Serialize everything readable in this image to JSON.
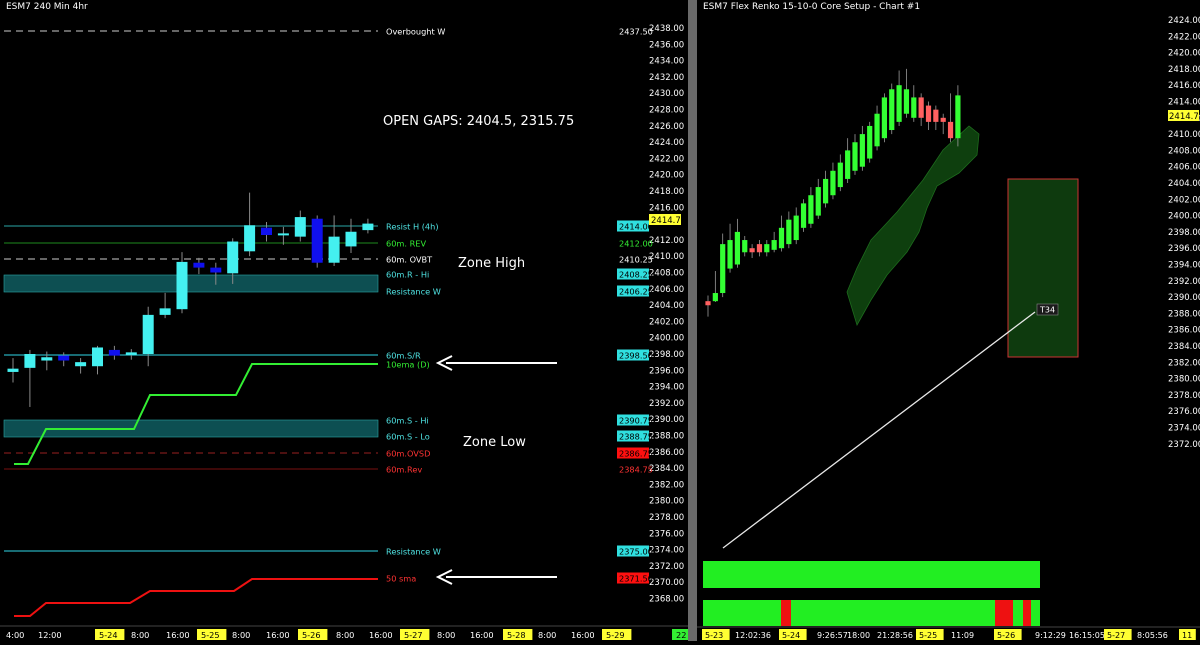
{
  "left_chart": {
    "title": "ESM7 240 Min  4hr",
    "open_gaps_text": "OPEN GAPS: 2404.5, 2315.75",
    "zone_high_label": "Zone High",
    "zone_low_label": "Zone Low",
    "y_ticks": [
      "2438.00",
      "2436.00",
      "2434.00",
      "2432.00",
      "2430.00",
      "2428.00",
      "2426.00",
      "2424.00",
      "2422.00",
      "2420.00",
      "2418.00",
      "2416.00",
      "2412.00",
      "2410.00",
      "2408.00",
      "2406.00",
      "2404.00",
      "2402.00",
      "2400.00",
      "2398.00",
      "2396.00",
      "2394.00",
      "2392.00",
      "2390.00",
      "2388.00",
      "2386.00",
      "2384.00",
      "2382.00",
      "2380.00",
      "2378.00",
      "2376.00",
      "2374.00",
      "2372.00",
      "2370.00",
      "2368.00"
    ],
    "x_labels": [
      {
        "t": "4:00",
        "hl": false
      },
      {
        "t": "12:00",
        "hl": false
      },
      {
        "t": "5-24",
        "hl": true
      },
      {
        "t": "8:00",
        "hl": false
      },
      {
        "t": "16:00",
        "hl": false
      },
      {
        "t": "5-25",
        "hl": true
      },
      {
        "t": "8:00",
        "hl": false
      },
      {
        "t": "16:00",
        "hl": false
      },
      {
        "t": "5-26",
        "hl": true
      },
      {
        "t": "8:00",
        "hl": false
      },
      {
        "t": "16:00",
        "hl": false
      },
      {
        "t": "5-27",
        "hl": true
      },
      {
        "t": "8:00",
        "hl": false
      },
      {
        "t": "16:00",
        "hl": false
      },
      {
        "t": "5-28",
        "hl": true
      },
      {
        "t": "8:00",
        "hl": false
      },
      {
        "t": "16:00",
        "hl": false
      },
      {
        "t": "5-29",
        "hl": true
      },
      {
        "t": "22",
        "hl": "green"
      }
    ],
    "levels": [
      {
        "name": "Overbought W",
        "value": "2437.50",
        "label_color": "#ffffff",
        "tag_bg": "none",
        "tag_fg": "#ffffff",
        "line": "#cccccc",
        "dash": true
      },
      {
        "name": "Resist H (4h)",
        "value": "2414.00",
        "label_color": "#4fe3e3",
        "tag_bg": "#30e0e0",
        "tag_fg": "#000000",
        "line": "#2aa6a6",
        "dash": false
      },
      {
        "name": "60m. REV",
        "value": "2412.00",
        "label_color": "#33ee33",
        "tag_bg": "none",
        "tag_fg": "#33ee33",
        "line": "#1e8a1e",
        "dash": false
      },
      {
        "name": "60m. OVBT",
        "value": "2410.25",
        "label_color": "#ffffff",
        "tag_bg": "none",
        "tag_fg": "#ffffff",
        "line": "#cccccc",
        "dash": true
      },
      {
        "name": "60m.R - Hi",
        "value": "2408.25",
        "label_color": "#4fe3e3",
        "tag_bg": "#30e0e0",
        "tag_fg": "#000000",
        "line": "none",
        "dash": false
      },
      {
        "name": "Resistance W",
        "value": "2406.25",
        "label_color": "#4fe3e3",
        "tag_bg": "#30e0e0",
        "tag_fg": "#000000",
        "line": "none",
        "dash": false
      },
      {
        "name": "60m.S/R",
        "value": "2398.50",
        "label_color": "#4fe3e3",
        "tag_bg": "#30e0e0",
        "tag_fg": "#000000",
        "line": "#30d8e8",
        "dash": false
      },
      {
        "name": "10ema (D)",
        "value": "",
        "label_color": "#33ee33",
        "tag_bg": "none",
        "tag_fg": "#33ee33",
        "line": "none",
        "dash": false
      },
      {
        "name": "60m.S - Hi",
        "value": "2390.75",
        "label_color": "#4fe3e3",
        "tag_bg": "#30e0e0",
        "tag_fg": "#000000",
        "line": "none",
        "dash": false
      },
      {
        "name": "60m.S - Lo",
        "value": "2388.75",
        "label_color": "#4fe3e3",
        "tag_bg": "#30e0e0",
        "tag_fg": "#000000",
        "line": "none",
        "dash": false
      },
      {
        "name": "60m.OVSD",
        "value": "2386.75",
        "label_color": "#ff3333",
        "tag_bg": "#ff1010",
        "tag_fg": "#000000",
        "line": "#992020",
        "dash": true
      },
      {
        "name": "60m.Rev",
        "value": "2384.75",
        "label_color": "#ff3333",
        "tag_bg": "none",
        "tag_fg": "#ff3333",
        "line": "#7a1010",
        "dash": false
      },
      {
        "name": "Resistance W",
        "value": "2375.00",
        "label_color": "#4fe3e3",
        "tag_bg": "#30e0e0",
        "tag_fg": "#000000",
        "line": "#30d8e8",
        "dash": false
      },
      {
        "name": "50 sma",
        "value": "2371.50",
        "label_color": "#ff3333",
        "tag_bg": "#ff1010",
        "tag_fg": "#000000",
        "line": "none",
        "dash": false
      }
    ],
    "last_price": "2414.75",
    "candles": [
      {
        "o": 2395.8,
        "c": 2396.2,
        "h": 2397.5,
        "l": 2394.5,
        "col": "cyan"
      },
      {
        "o": 2396.3,
        "c": 2398.0,
        "h": 2398.5,
        "l": 2391.5,
        "col": "cyan"
      },
      {
        "o": 2397.2,
        "c": 2397.6,
        "h": 2398.3,
        "l": 2396.0,
        "col": "cyan"
      },
      {
        "o": 2397.8,
        "c": 2397.2,
        "h": 2398.2,
        "l": 2396.5,
        "col": "blue"
      },
      {
        "o": 2396.5,
        "c": 2397.0,
        "h": 2397.5,
        "l": 2395.6,
        "col": "cyan"
      },
      {
        "o": 2396.5,
        "c": 2398.8,
        "h": 2399.0,
        "l": 2395.5,
        "col": "cyan"
      },
      {
        "o": 2398.5,
        "c": 2397.8,
        "h": 2399.0,
        "l": 2397.3,
        "col": "blue"
      },
      {
        "o": 2397.9,
        "c": 2398.2,
        "h": 2398.6,
        "l": 2397.3,
        "col": "cyan"
      },
      {
        "o": 2398.0,
        "c": 2402.8,
        "h": 2403.8,
        "l": 2396.5,
        "col": "cyan"
      },
      {
        "o": 2402.8,
        "c": 2403.6,
        "h": 2405.5,
        "l": 2402.4,
        "col": "cyan"
      },
      {
        "o": 2403.5,
        "c": 2409.3,
        "h": 2410.5,
        "l": 2403.0,
        "col": "cyan"
      },
      {
        "o": 2409.2,
        "c": 2408.6,
        "h": 2409.8,
        "l": 2407.8,
        "col": "blue"
      },
      {
        "o": 2408.6,
        "c": 2408.0,
        "h": 2409.2,
        "l": 2406.5,
        "col": "blue"
      },
      {
        "o": 2407.9,
        "c": 2411.8,
        "h": 2412.2,
        "l": 2406.6,
        "col": "cyan"
      },
      {
        "o": 2410.6,
        "c": 2413.8,
        "h": 2417.8,
        "l": 2410.0,
        "col": "cyan"
      },
      {
        "o": 2413.5,
        "c": 2412.6,
        "h": 2414.2,
        "l": 2411.8,
        "col": "blue"
      },
      {
        "o": 2412.6,
        "c": 2412.8,
        "h": 2413.6,
        "l": 2411.4,
        "col": "cyan"
      },
      {
        "o": 2412.4,
        "c": 2414.8,
        "h": 2415.6,
        "l": 2411.8,
        "col": "cyan"
      },
      {
        "o": 2414.6,
        "c": 2409.2,
        "h": 2415.0,
        "l": 2408.6,
        "col": "blue"
      },
      {
        "o": 2409.2,
        "c": 2412.4,
        "h": 2415.0,
        "l": 2408.8,
        "col": "cyan"
      },
      {
        "o": 2411.2,
        "c": 2413.0,
        "h": 2414.6,
        "l": 2410.4,
        "col": "cyan"
      },
      {
        "o": 2413.2,
        "c": 2414.0,
        "h": 2414.6,
        "l": 2412.8,
        "col": "cyan"
      }
    ]
  },
  "right_chart": {
    "title": "ESM7 Flex Renko 15-10-0 Core Setup - Chart #1",
    "y_ticks": [
      "2424.00",
      "2422.00",
      "2420.00",
      "2418.00",
      "2416.00",
      "2414.00",
      "2412.00",
      "2410.00",
      "2408.00",
      "2406.00",
      "2404.00",
      "2402.00",
      "2400.00",
      "2398.00",
      "2396.00",
      "2394.00",
      "2392.00",
      "2390.00",
      "2388.00",
      "2386.00",
      "2384.00",
      "2382.00",
      "2380.00",
      "2378.00",
      "2376.00",
      "2374.00",
      "2372.00"
    ],
    "last_price": "2414.75",
    "marker_label": "T34",
    "x_labels": [
      {
        "t": "5-23",
        "hl": true
      },
      {
        "t": "12:02:36",
        "hl": false
      },
      {
        "t": "5-24",
        "hl": true
      },
      {
        "t": "9:26:57",
        "hl": false
      },
      {
        "t": "18:00",
        "hl": false
      },
      {
        "t": "21:28:56",
        "hl": false
      },
      {
        "t": "5-25",
        "hl": true
      },
      {
        "t": "11:09",
        "hl": false
      },
      {
        "t": "5-26",
        "hl": true
      },
      {
        "t": "9:12:29",
        "hl": false
      },
      {
        "t": "16:15:05",
        "hl": false
      },
      {
        "t": "5-27",
        "hl": true
      },
      {
        "t": "8:05:56",
        "hl": false
      },
      {
        "t": "11",
        "hl": true
      }
    ],
    "bricks": [
      {
        "o": 2389.5,
        "c": 2389.0,
        "h": 2390.2,
        "l": 2387.6,
        "col": "red"
      },
      {
        "o": 2389.5,
        "c": 2390.5,
        "h": 2393.2,
        "l": 2389.4,
        "col": "green"
      },
      {
        "o": 2390.5,
        "c": 2396.5,
        "h": 2397.8,
        "l": 2390.0,
        "col": "green"
      },
      {
        "o": 2393.5,
        "c": 2397.0,
        "h": 2399.0,
        "l": 2393.0,
        "col": "green"
      },
      {
        "o": 2394.0,
        "c": 2398.0,
        "h": 2399.6,
        "l": 2393.6,
        "col": "green"
      },
      {
        "o": 2395.5,
        "c": 2397.0,
        "h": 2397.5,
        "l": 2395.0,
        "col": "green"
      },
      {
        "o": 2396.0,
        "c": 2395.5,
        "h": 2396.5,
        "l": 2394.8,
        "col": "red"
      },
      {
        "o": 2396.5,
        "c": 2395.5,
        "h": 2397.0,
        "l": 2395.0,
        "col": "red"
      },
      {
        "o": 2395.5,
        "c": 2396.5,
        "h": 2397.0,
        "l": 2395.0,
        "col": "green"
      },
      {
        "o": 2395.8,
        "c": 2397.0,
        "h": 2398.0,
        "l": 2395.5,
        "col": "green"
      },
      {
        "o": 2396.0,
        "c": 2398.5,
        "h": 2400.0,
        "l": 2395.6,
        "col": "green"
      },
      {
        "o": 2396.5,
        "c": 2399.5,
        "h": 2400.5,
        "l": 2396.0,
        "col": "green"
      },
      {
        "o": 2397.0,
        "c": 2400.0,
        "h": 2401.0,
        "l": 2396.5,
        "col": "green"
      },
      {
        "o": 2398.5,
        "c": 2401.5,
        "h": 2402.0,
        "l": 2398.0,
        "col": "green"
      },
      {
        "o": 2399.0,
        "c": 2402.5,
        "h": 2403.5,
        "l": 2398.5,
        "col": "green"
      },
      {
        "o": 2400.0,
        "c": 2403.5,
        "h": 2404.5,
        "l": 2399.6,
        "col": "green"
      },
      {
        "o": 2401.5,
        "c": 2404.5,
        "h": 2405.5,
        "l": 2401.0,
        "col": "green"
      },
      {
        "o": 2402.5,
        "c": 2405.5,
        "h": 2406.5,
        "l": 2402.0,
        "col": "green"
      },
      {
        "o": 2403.5,
        "c": 2406.5,
        "h": 2407.5,
        "l": 2403.0,
        "col": "green"
      },
      {
        "o": 2404.5,
        "c": 2408.0,
        "h": 2409.5,
        "l": 2404.0,
        "col": "green"
      },
      {
        "o": 2405.5,
        "c": 2409.0,
        "h": 2410.0,
        "l": 2405.0,
        "col": "green"
      },
      {
        "o": 2406.0,
        "c": 2410.0,
        "h": 2411.0,
        "l": 2405.5,
        "col": "green"
      },
      {
        "o": 2407.0,
        "c": 2411.0,
        "h": 2411.5,
        "l": 2406.5,
        "col": "green"
      },
      {
        "o": 2408.5,
        "c": 2412.5,
        "h": 2413.5,
        "l": 2408.0,
        "col": "green"
      },
      {
        "o": 2409.5,
        "c": 2414.5,
        "h": 2415.0,
        "l": 2409.0,
        "col": "green"
      },
      {
        "o": 2410.5,
        "c": 2415.5,
        "h": 2416.2,
        "l": 2410.0,
        "col": "green"
      },
      {
        "o": 2411.5,
        "c": 2416.0,
        "h": 2417.8,
        "l": 2411.0,
        "col": "green"
      },
      {
        "o": 2412.5,
        "c": 2415.5,
        "h": 2418.0,
        "l": 2412.0,
        "col": "green"
      },
      {
        "o": 2412.0,
        "c": 2414.5,
        "h": 2416.0,
        "l": 2411.5,
        "col": "green"
      },
      {
        "o": 2414.5,
        "c": 2412.0,
        "h": 2415.0,
        "l": 2411.0,
        "col": "red"
      },
      {
        "o": 2413.5,
        "c": 2411.5,
        "h": 2414.0,
        "l": 2410.5,
        "col": "red"
      },
      {
        "o": 2413.0,
        "c": 2411.5,
        "h": 2413.5,
        "l": 2410.5,
        "col": "red"
      },
      {
        "o": 2412.0,
        "c": 2411.5,
        "h": 2412.5,
        "l": 2410.0,
        "col": "red"
      },
      {
        "o": 2411.5,
        "c": 2409.5,
        "h": 2415.0,
        "l": 2409.0,
        "col": "red"
      },
      {
        "o": 2409.5,
        "c": 2414.75,
        "h": 2416.0,
        "l": 2408.5,
        "col": "green"
      }
    ],
    "indicator_row2_red_blocks": [
      0.12,
      0.83,
      0.91
    ]
  }
}
